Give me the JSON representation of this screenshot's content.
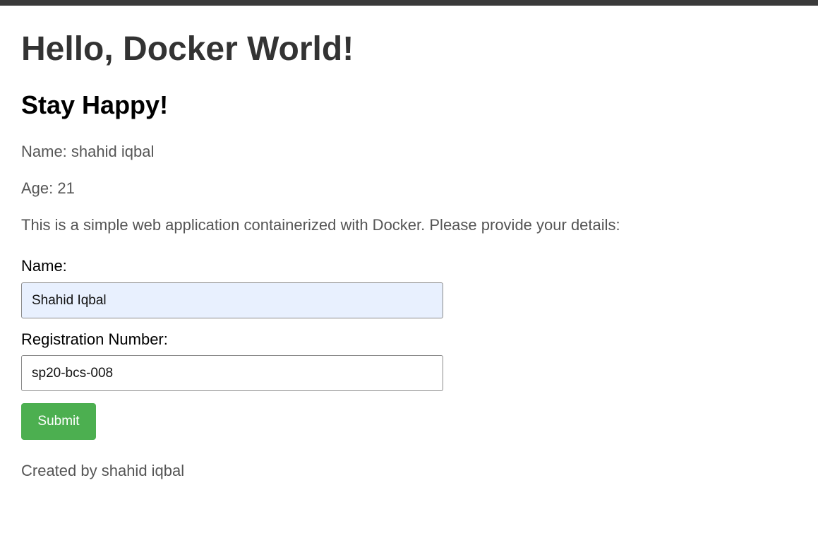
{
  "page": {
    "title": "Hello, Docker World!",
    "subtitle": "Stay Happy!",
    "name_line": "Name: shahid iqbal",
    "age_line": "Age: 21",
    "description": "This is a simple web application containerized with Docker. Please provide your details:",
    "footer": "Created by shahid iqbal"
  },
  "form": {
    "name_label": "Name:",
    "name_value": "Shahid Iqbal",
    "reg_label": "Registration Number:",
    "reg_value": "sp20-bcs-008",
    "submit_label": "Submit"
  },
  "colors": {
    "accent": "#4caf50",
    "autofill": "#e8f0fe",
    "heading": "#333333",
    "text": "#555555"
  }
}
